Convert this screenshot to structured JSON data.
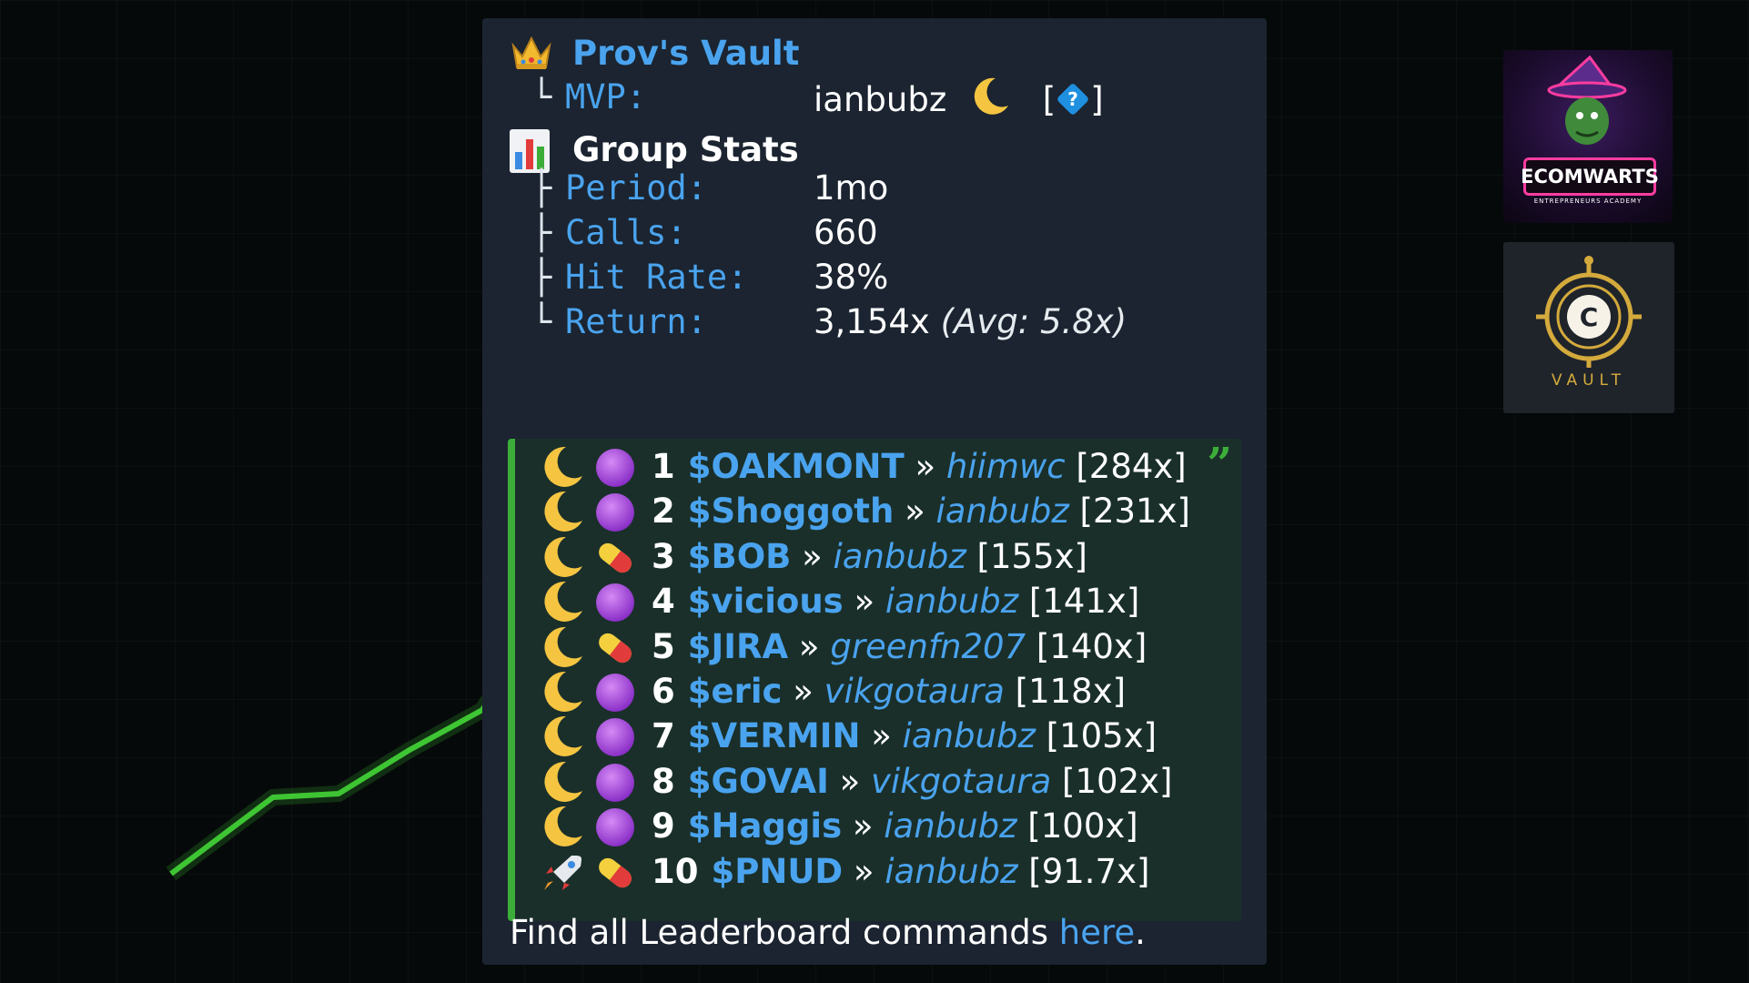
{
  "header": {
    "title": "Prov's Vault",
    "mvp_label": "MVP:",
    "mvp_user": "ianbubz",
    "mvp_badge": "[",
    "mvp_badge_close": "]"
  },
  "stats": {
    "title": "Group Stats",
    "rows": [
      {
        "key": "Period:",
        "value": "1mo"
      },
      {
        "key": "Calls:",
        "value": "660"
      },
      {
        "key": "Hit Rate:",
        "value": "38%"
      },
      {
        "key": "Return:",
        "value": "3,154x",
        "extra": "(Avg: 5.8x)"
      }
    ],
    "tree_glyphs": [
      "├",
      "├",
      "├",
      "└"
    ]
  },
  "leaderboard": [
    {
      "rank": "1",
      "ticker": "$OAKMONT",
      "user": "hiimwc",
      "mult": "[284x]",
      "badge": "purple-circle"
    },
    {
      "rank": "2",
      "ticker": "$Shoggoth",
      "user": "ianbubz",
      "mult": "[231x]",
      "badge": "purple-circle"
    },
    {
      "rank": "3",
      "ticker": "$BOB",
      "user": "ianbubz",
      "mult": "[155x]",
      "badge": "pill"
    },
    {
      "rank": "4",
      "ticker": "$vicious",
      "user": "ianbubz",
      "mult": "[141x]",
      "badge": "purple-circle"
    },
    {
      "rank": "5",
      "ticker": "$JIRA",
      "user": "greenfn207",
      "mult": "[140x]",
      "badge": "pill"
    },
    {
      "rank": "6",
      "ticker": "$eric",
      "user": "vikgotaura",
      "mult": "[118x]",
      "badge": "purple-circle"
    },
    {
      "rank": "7",
      "ticker": "$VERMIN",
      "user": "ianbubz",
      "mult": "[105x]",
      "badge": "purple-circle"
    },
    {
      "rank": "8",
      "ticker": "$GOVAI",
      "user": "vikgotaura",
      "mult": "[102x]",
      "badge": "purple-circle"
    },
    {
      "rank": "9",
      "ticker": "$Haggis",
      "user": "ianbubz",
      "mult": "[100x]",
      "badge": "purple-circle"
    },
    {
      "rank": "10",
      "ticker": "$PNUD",
      "user": "ianbubz",
      "mult": "[91.7x]",
      "badge": "pill"
    }
  ],
  "separator": "»",
  "footer": {
    "text": "Find all Leaderboard commands ",
    "link": "here",
    "end": "."
  },
  "logos": {
    "ecomwarts": "ECOMWARTS",
    "ecomwarts_sub": "ENTREPRENEURS ACADEMY",
    "vault": "VAULT"
  },
  "colors": {
    "accent_blue": "#4aa3ee",
    "quote_green": "#3dad3a",
    "card_bg": "#1b2430"
  }
}
